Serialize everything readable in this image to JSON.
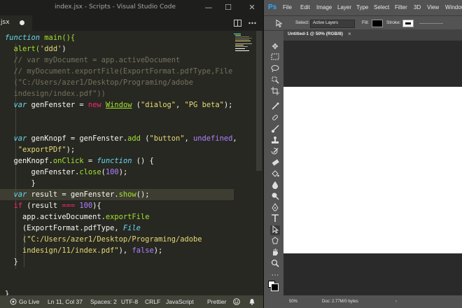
{
  "vscode": {
    "title": "index.jsx - Scripts - Visual Studio Code",
    "tab_label": "jsx",
    "minimize_glyph": "—",
    "restore_glyph": "☐",
    "close_glyph": "✕",
    "status": {
      "live": "Go Live",
      "position": "Ln 11, Col 37",
      "spaces": "Spaces: 2",
      "encoding": "UTF-8",
      "eol": "CRLF",
      "language": "JavaScript",
      "formatter": "Prettier"
    },
    "code": {
      "l1a": "function",
      "l1b": " main(){",
      "l2a": "  alert(",
      "l2b": "'ddd'",
      "l2c": ")",
      "l3": "  // var myDocument = app.activeDocument",
      "l4": "  // myDocument.exportFile(ExportFormat.pdfType,File",
      "l5": "  (\"C:/Users/azer1/Desktop/Programing/adobe",
      "l6": "  indesign/index.pdf\"))",
      "l7a": "  var",
      "l7b": " genFenster = ",
      "l7c": "new",
      "l7d": " ",
      "l7e": "Window",
      "l7f": " (",
      "l7g": "\"dialog\"",
      "l7h": ", ",
      "l7i": "\"PG beta\"",
      "l7j": ");",
      "l10a": "  var",
      "l10b": " genKnopf = genFenster.",
      "l10c": "add",
      "l10d": " (",
      "l10e": "\"button\"",
      "l10f": ", ",
      "l10g": "undefined",
      "l10h": ",",
      "l11": "   \"exportPDf\"",
      "l11b": ");",
      "l12a": "  genKnopf.",
      "l12b": "onClick",
      "l12c": " = ",
      "l12d": "function",
      "l12e": " () {",
      "l13a": "      genFenster.",
      "l13b": "close",
      "l13c": "(",
      "l13d": "100",
      "l13e": ");",
      "l14": "      }",
      "l15a": "  var",
      "l15b": " result = genFenster.",
      "l15c": "show",
      "l15d": "();",
      "l16a": "  if",
      "l16b": " (result ",
      "l16c": "===",
      "l16d": " ",
      "l16e": "100",
      "l16f": "){",
      "l17a": "    app.activeDocument.",
      "l17b": "exportFile",
      "l18a": "    (ExportFormat.pdfType, ",
      "l18b": "File",
      "l19": "    (\"C:/Users/azer1/Desktop/Programing/adobe",
      "l20a": "    indesign/11/index.pdf\"",
      "l20b": "), ",
      "l20c": "false",
      "l20d": ");",
      "l21": "  }",
      "l22": "}"
    }
  },
  "photoshop": {
    "logo": "Ps",
    "menu": [
      "File",
      "Edit",
      "Image",
      "Layer",
      "Type",
      "Select",
      "Filter",
      "3D",
      "View",
      "Window"
    ],
    "options": {
      "select_label": "Select:",
      "select_value": "Active Layers",
      "fill_label": "Fill:",
      "stroke_label": "Stroke:"
    },
    "document_tab": "Untitled-1 @ 50% (RGB/8)",
    "close_tab_glyph": "×",
    "status": {
      "zoom": "50%",
      "doc": "Doc: 2.77M/0 bytes"
    },
    "colors": {
      "fill": "#000000",
      "stroke": "#ffffff"
    }
  }
}
